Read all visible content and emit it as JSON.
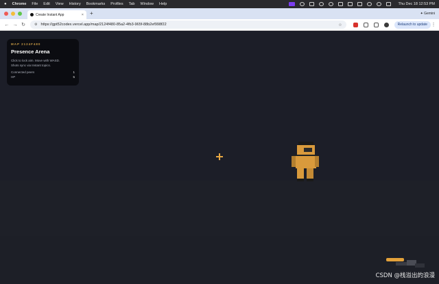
{
  "menubar": {
    "app": "Chrome",
    "items": [
      "File",
      "Edit",
      "View",
      "History",
      "Bookmarks",
      "Profiles",
      "Tab",
      "Window",
      "Help"
    ],
    "clock": "Thu Dec 18  12:53 PM"
  },
  "tabs": {
    "active_title": "Create Instant App",
    "gemini_label": "Gemini"
  },
  "toolbar": {
    "url": "https://gpt52codex.vercel.app/map/2124f480-85a2-4fb3-965f-88b2ef998f22",
    "relaunch_label": "Relaunch to update"
  },
  "hud": {
    "map_id": "MAP 2124F480",
    "title": "Presence Arena",
    "instructions_line1": "Click to lock aim. Move with WASD.",
    "instructions_line2": "Shots sync via Instant topics.",
    "connected_label": "Connected peers",
    "connected_value": "1",
    "hp_label": "HP",
    "hp_value": "5"
  },
  "colors": {
    "accent": "#e8a842",
    "hud_bg": "#0a0b0f",
    "world_bg": "#1b1d27",
    "avatar_body": "#d99a3c"
  },
  "watermark": "CSDN @栈溢出的浪漫"
}
